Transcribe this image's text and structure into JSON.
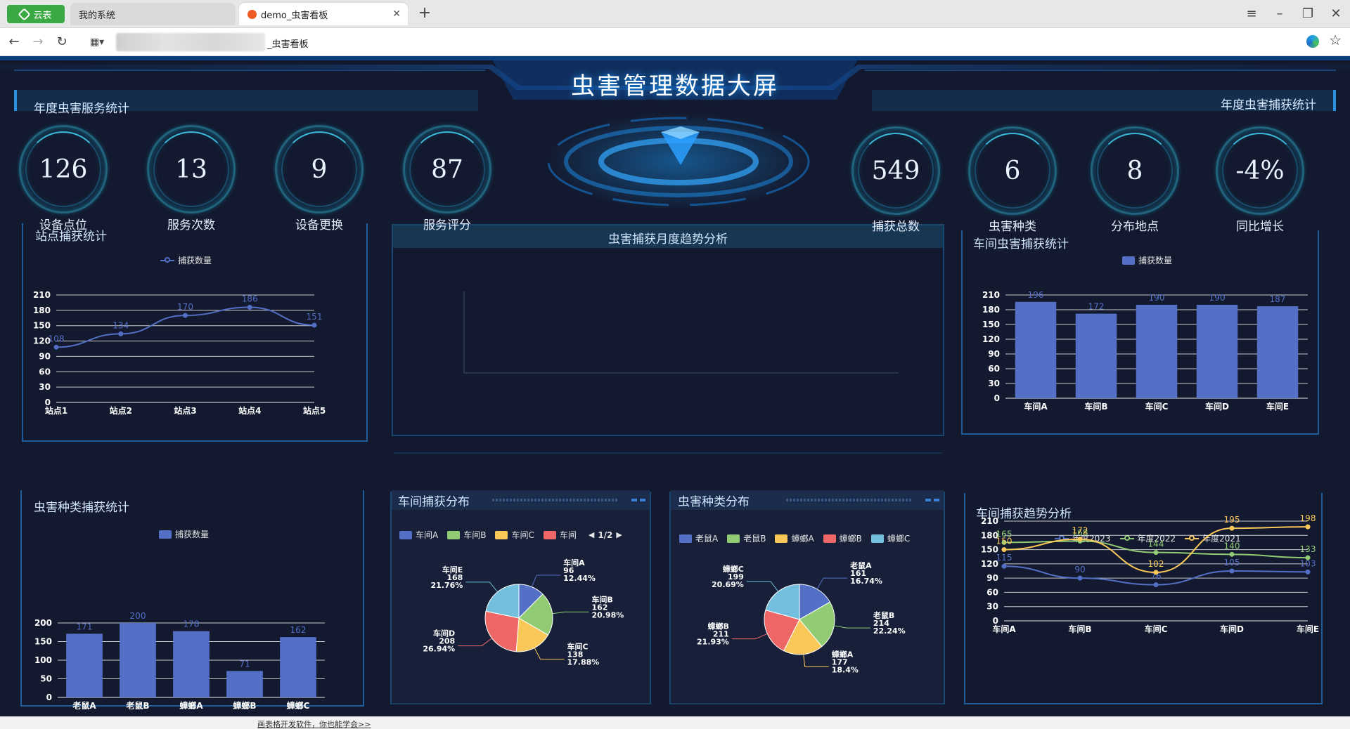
{
  "browser": {
    "app_label": "云表",
    "tabs": [
      {
        "label": "我的系统",
        "active": false
      },
      {
        "label": "demo_虫害看板",
        "active": true
      }
    ],
    "address_text": "_虫害看板",
    "status_link": "画表格开发软件，你也能学会>>"
  },
  "dashboard": {
    "title": "虫害管理数据大屏",
    "left_section": "年度虫害服务统计",
    "right_section": "年度虫害捕获统计",
    "kpis_left": [
      {
        "value": "126",
        "label": "设备点位"
      },
      {
        "value": "13",
        "label": "服务次数"
      },
      {
        "value": "9",
        "label": "设备更换"
      },
      {
        "value": "87",
        "label": "服务评分"
      }
    ],
    "kpis_right": [
      {
        "value": "549",
        "label": "捕获总数"
      },
      {
        "value": "6",
        "label": "虫害种类"
      },
      {
        "value": "8",
        "label": "分布地点"
      },
      {
        "value": "-4%",
        "label": "同比增长"
      }
    ],
    "colors": {
      "blue": "#5470c6",
      "green": "#91cc75",
      "yellow": "#fac858",
      "red": "#ee6666",
      "cyan": "#73c0de"
    }
  },
  "chart_data": [
    {
      "id": "site",
      "type": "line",
      "title": "站点捕获统计",
      "legend": [
        "捕获数量"
      ],
      "categories": [
        "站点1",
        "站点2",
        "站点3",
        "站点4",
        "站点5"
      ],
      "series": [
        {
          "name": "捕获数量",
          "values": [
            108,
            134,
            170,
            186,
            151
          ]
        }
      ],
      "ylim": [
        0,
        210
      ],
      "yticks": [
        0,
        30,
        60,
        90,
        120,
        150,
        180,
        210
      ]
    },
    {
      "id": "monthly",
      "type": "line",
      "title": "虫害捕获月度趋势分析",
      "categories": [],
      "series": []
    },
    {
      "id": "workshop_bar",
      "type": "bar",
      "title": "车间虫害捕获统计",
      "legend": [
        "捕获数量"
      ],
      "categories": [
        "车间A",
        "车间B",
        "车间C",
        "车间D",
        "车间E"
      ],
      "series": [
        {
          "name": "捕获数量",
          "values": [
            196,
            172,
            190,
            190,
            187
          ]
        }
      ],
      "ylim": [
        0,
        210
      ],
      "yticks": [
        0,
        30,
        60,
        90,
        120,
        150,
        180,
        210
      ]
    },
    {
      "id": "species_bar",
      "type": "bar",
      "title": "虫害种类捕获统计",
      "legend": [
        "捕获数量"
      ],
      "categories": [
        "老鼠A",
        "老鼠B",
        "蟑螂A",
        "蟑螂B",
        "蟑螂C"
      ],
      "series": [
        {
          "name": "捕获数量",
          "values": [
            171,
            200,
            178,
            71,
            162
          ]
        }
      ],
      "ylim": [
        0,
        200
      ],
      "yticks": [
        0,
        50,
        100,
        150,
        200
      ]
    },
    {
      "id": "workshop_pie",
      "type": "pie",
      "title": "车间捕获分布",
      "legend": [
        "车间A",
        "车间B",
        "车间C",
        "车间"
      ],
      "legend_page": "1/2",
      "slices": [
        {
          "name": "车间A",
          "value": "96",
          "percent": "12.44%"
        },
        {
          "name": "车间B",
          "value": "162",
          "percent": "20.98%"
        },
        {
          "name": "车间C",
          "value": "138",
          "percent": "17.88%"
        },
        {
          "name": "车间D",
          "value": "208",
          "percent": "26.94%"
        },
        {
          "name": "车间E",
          "value": "168",
          "percent": "21.76%"
        }
      ]
    },
    {
      "id": "species_pie",
      "type": "pie",
      "title": "虫害种类分布",
      "legend": [
        "老鼠A",
        "老鼠B",
        "蟑螂A",
        "蟑螂B",
        "蟑螂C"
      ],
      "slices": [
        {
          "name": "老鼠A",
          "value": "161",
          "percent": "16.74%"
        },
        {
          "name": "老鼠B",
          "value": "214",
          "percent": "22.24%"
        },
        {
          "name": "蟑螂A",
          "value": "177",
          "percent": "18.4%"
        },
        {
          "name": "蟑螂B",
          "value": "211",
          "percent": "21.93%"
        },
        {
          "name": "蟑螂C",
          "value": "199",
          "percent": "20.69%"
        }
      ]
    },
    {
      "id": "trend",
      "type": "line",
      "title": "车间捕获趋势分析",
      "legend": [
        "年度2023",
        "年度2022",
        "年度2021"
      ],
      "categories": [
        "车间A",
        "车间B",
        "车间C",
        "车间D",
        "车间E"
      ],
      "series": [
        {
          "name": "年度2023",
          "values": [
            115,
            90,
            76,
            105,
            103
          ]
        },
        {
          "name": "年度2022",
          "values": [
            165,
            168,
            144,
            140,
            133
          ]
        },
        {
          "name": "年度2021",
          "values": [
            150,
            172,
            102,
            195,
            198
          ]
        }
      ],
      "ylim": [
        0,
        210
      ],
      "yticks": [
        0,
        30,
        60,
        90,
        120,
        150,
        180,
        210
      ]
    }
  ]
}
